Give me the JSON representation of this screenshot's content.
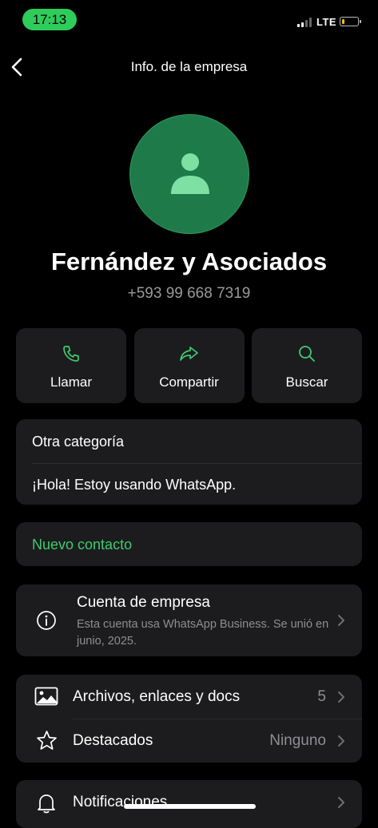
{
  "status_bar": {
    "time": "17:13",
    "network": "LTE",
    "battery_level": 0.15,
    "colors": {
      "time_pill": "#2ecc5a",
      "battery": "#f2c200"
    }
  },
  "header": {
    "title": "Info. de la empresa",
    "back_icon": "chevron-left-icon"
  },
  "profile": {
    "name": "Fernández y Asociados",
    "phone": "+593 99 668 7319",
    "avatar_icon": "person-icon",
    "avatar_color": "#1f7a4a"
  },
  "actions": [
    {
      "label": "Llamar",
      "icon": "phone-icon"
    },
    {
      "label": "Compartir",
      "icon": "share-arrow-icon"
    },
    {
      "label": "Buscar",
      "icon": "search-icon"
    }
  ],
  "about": {
    "category": "Otra categoría",
    "status": "¡Hola! Estoy usando WhatsApp."
  },
  "new_contact": {
    "label": "Nuevo contacto",
    "color": "#3dcc6e"
  },
  "business": {
    "title": "Cuenta de empresa",
    "description": "Esta cuenta usa WhatsApp Business. Se unió en junio, 2025.",
    "icon": "info-icon"
  },
  "media": [
    {
      "label": "Archivos, enlaces y docs",
      "value": "5",
      "icon": "image-icon"
    },
    {
      "label": "Destacados",
      "value": "Ninguno",
      "icon": "star-icon"
    }
  ],
  "notifications": {
    "label": "Notificaciones",
    "icon": "bell-icon"
  }
}
